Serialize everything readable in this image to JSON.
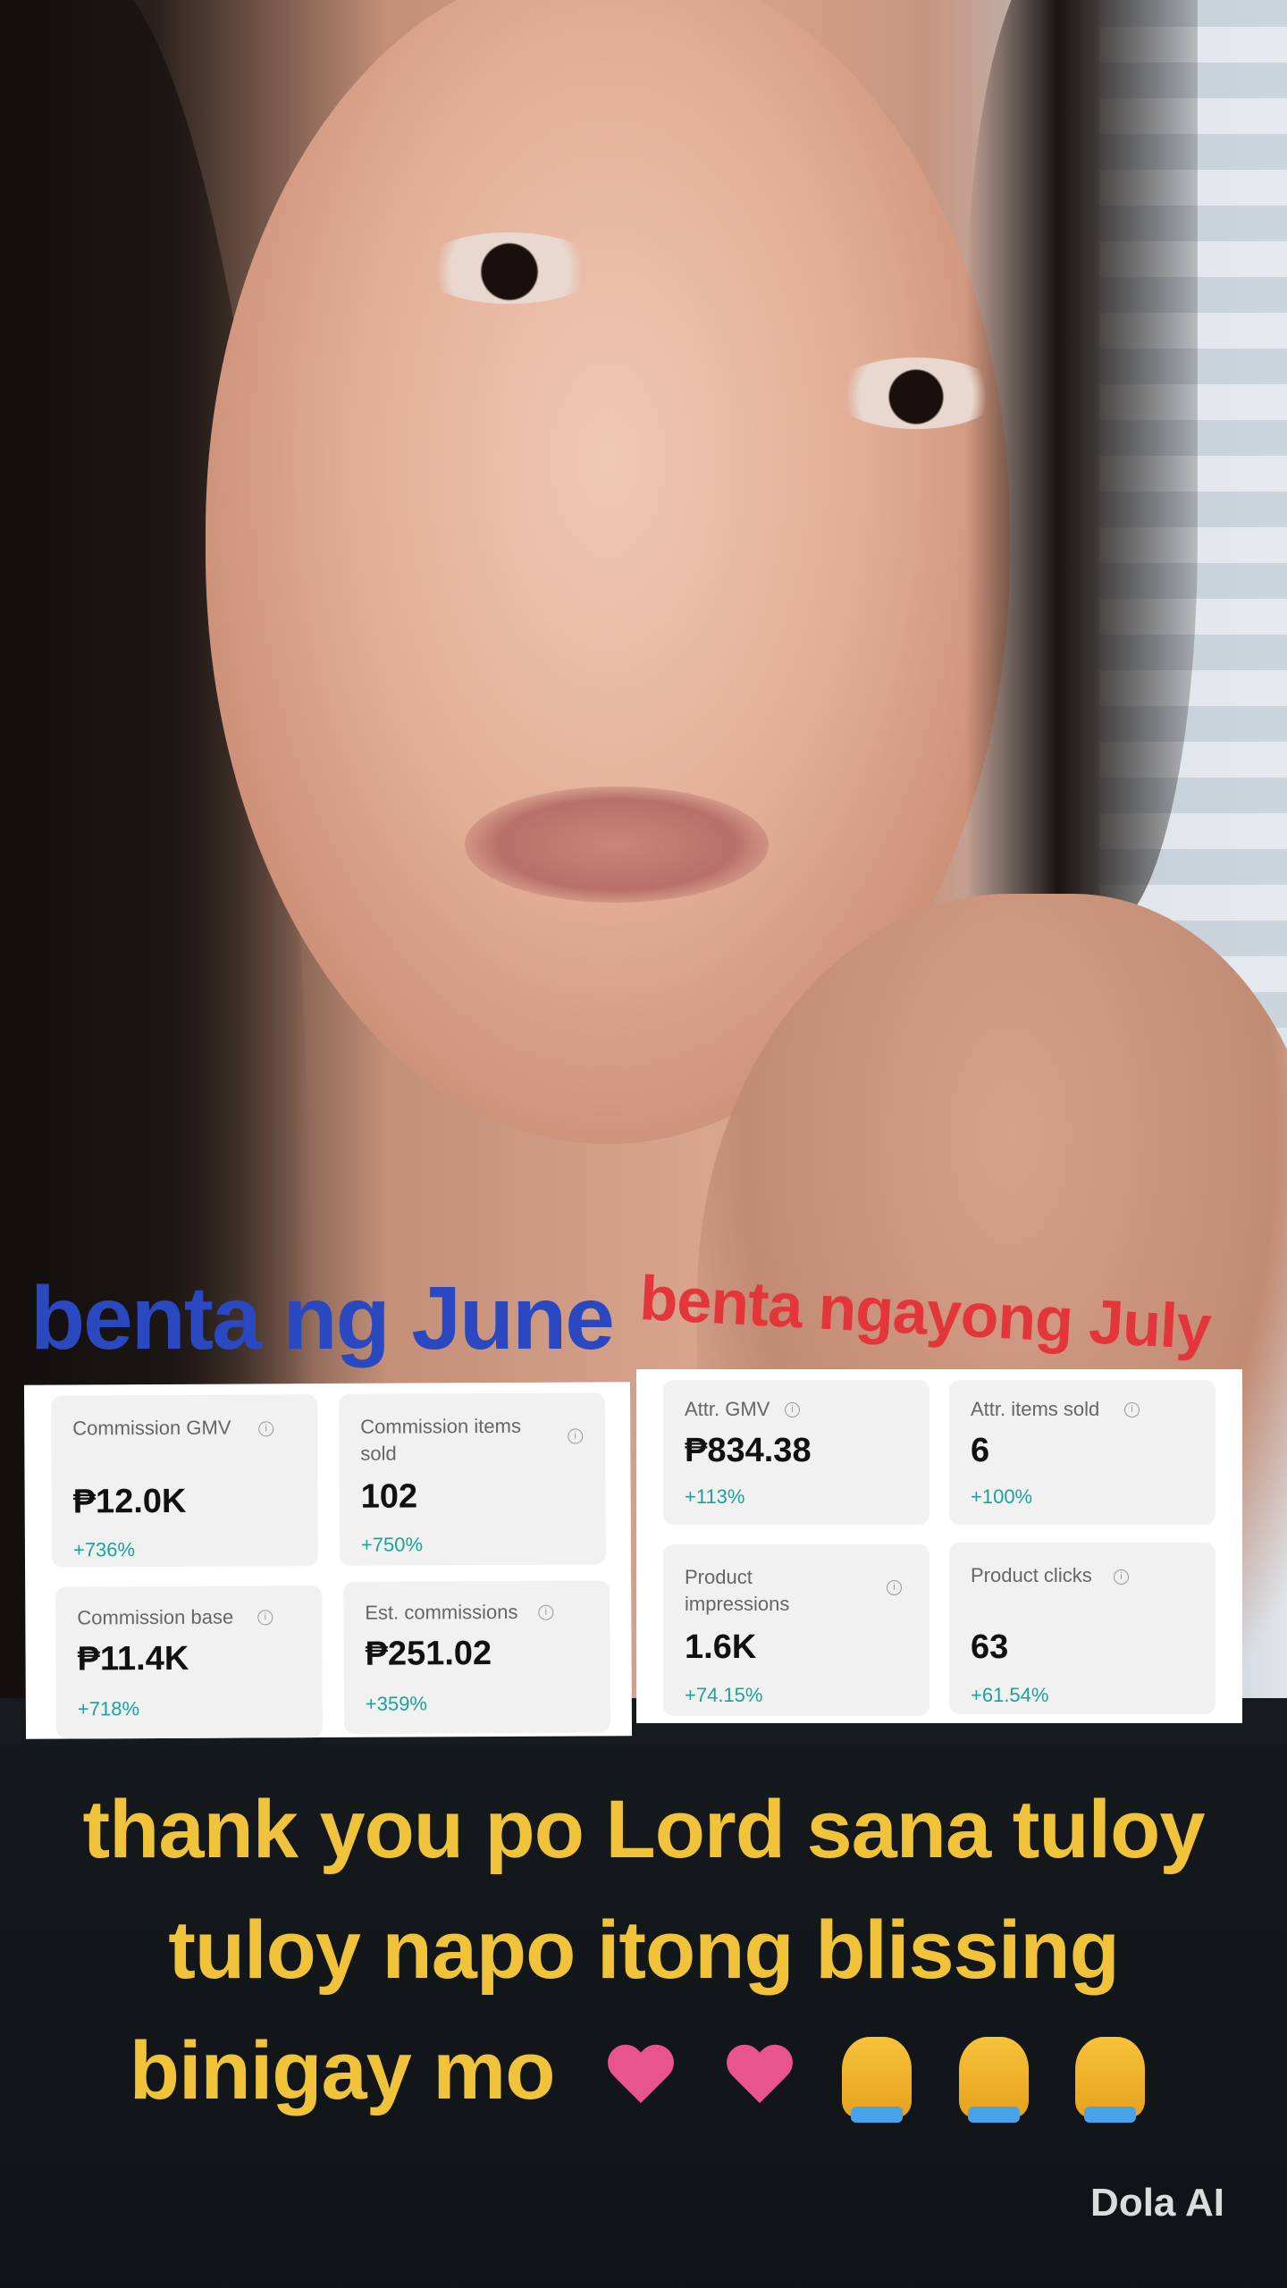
{
  "captions": {
    "top_left": "benta ng June",
    "top_right": "benta ngayong July",
    "bottom_lines": [
      "thank you po Lord sana tuloy",
      "tuloy napo itong blissing",
      "binigay mo"
    ]
  },
  "june_panel": {
    "cards": [
      {
        "label": "Commission GMV",
        "value": "₱12.0K",
        "delta": "+736%"
      },
      {
        "label": "Commission items sold",
        "value": "102",
        "delta": "+750%"
      },
      {
        "label": "Commission base",
        "value": "₱11.4K",
        "delta": "+718%"
      },
      {
        "label": "Est. commissions",
        "value": "₱251.02",
        "delta": "+359%"
      }
    ]
  },
  "july_panel": {
    "cards": [
      {
        "label": "Attr. GMV",
        "value": "₱834.38",
        "delta": "+113%"
      },
      {
        "label": "Attr. items sold",
        "value": "6",
        "delta": "+100%"
      },
      {
        "label": "Product impressions",
        "value": "1.6K",
        "delta": "+74.15%"
      },
      {
        "label": "Product clicks",
        "value": "63",
        "delta": "+61.54%"
      }
    ]
  },
  "emojis": [
    "heart-icon",
    "heart-icon",
    "praying-hands-icon",
    "praying-hands-icon",
    "praying-hands-icon"
  ],
  "watermark": "Dola AI",
  "info_glyph": "i",
  "colors": {
    "june_caption": "#2a49c0",
    "july_caption": "#e2363c",
    "bottom_caption": "#f0c33a",
    "delta_teal": "#1aa39a"
  }
}
